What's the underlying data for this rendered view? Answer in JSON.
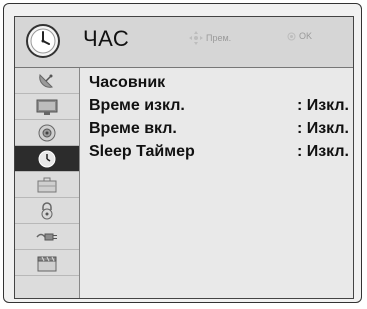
{
  "header": {
    "title": "ЧАС",
    "move_label": "Прем.",
    "ok_label": "OK"
  },
  "sidebar": {
    "items": [
      {
        "icon": "satellite-dish-icon",
        "active": false
      },
      {
        "icon": "monitor-icon",
        "active": false
      },
      {
        "icon": "speaker-icon",
        "active": false
      },
      {
        "icon": "clock-icon",
        "active": true
      },
      {
        "icon": "toolbox-icon",
        "active": false
      },
      {
        "icon": "lock-icon",
        "active": false
      },
      {
        "icon": "cable-plug-icon",
        "active": false
      },
      {
        "icon": "clapperboard-icon",
        "active": false
      }
    ]
  },
  "menu": {
    "rows": [
      {
        "label": "Часовник",
        "value": ""
      },
      {
        "label": "Време изкл.",
        "value": ": Изкл."
      },
      {
        "label": "Време вкл.",
        "value": ": Изкл."
      },
      {
        "label": "Sleep Таймер",
        "value": ": Изкл."
      }
    ]
  },
  "colors": {
    "active_item_bg": "#2c2c2c",
    "header_bg": "#d6d6d6",
    "panel_bg": "#e9e9e9"
  }
}
